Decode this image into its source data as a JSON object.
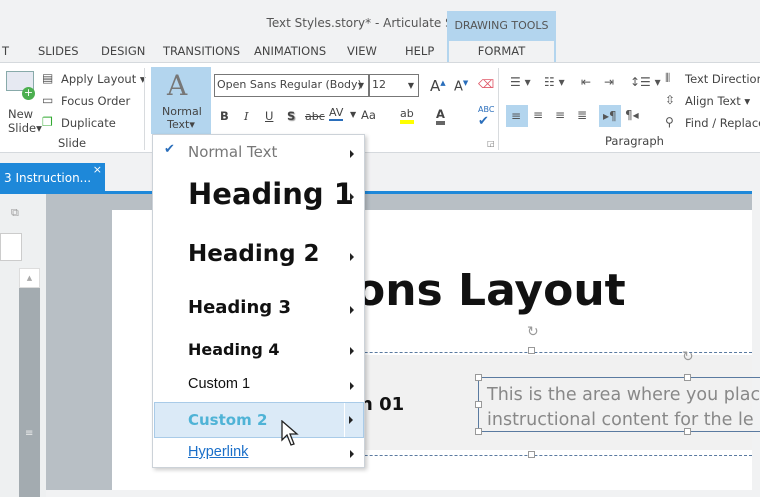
{
  "window": {
    "title": "Text Styles.story* -  Articulate Storyline"
  },
  "tabs": [
    "T",
    "SLIDES",
    "DESIGN",
    "TRANSITIONS",
    "ANIMATIONS",
    "VIEW",
    "HELP"
  ],
  "contextual": {
    "group": "DRAWING TOOLS",
    "tab": "FORMAT"
  },
  "ribbon": {
    "slide": {
      "new_slide": [
        "New",
        "Slide"
      ],
      "apply_layout": "Apply Layout",
      "focus_order": "Focus Order",
      "duplicate": "Duplicate",
      "group": "Slide"
    },
    "style_button": [
      "Normal",
      "Text"
    ],
    "font": {
      "name": "Open Sans Regular (Body)",
      "size": "12"
    },
    "format": {
      "bold": "B",
      "italic": "I",
      "underline": "U",
      "shadow": "S",
      "strike": "abc",
      "spacing": "AV",
      "case": "Aa",
      "highlight_color": "#ffff00"
    },
    "paragraph": {
      "group": "Paragraph",
      "text_direction": "Text Direction",
      "align_text": "Align Text",
      "find_replace": "Find / Replace"
    }
  },
  "doc_tab": {
    "label": "3 Instruction...",
    "close": "×",
    "color": "#1e88d9"
  },
  "menu": {
    "items": [
      {
        "label": "Normal Text",
        "checked": true
      },
      {
        "label": "Heading 1"
      },
      {
        "label": "Heading 2"
      },
      {
        "label": "Heading 3"
      },
      {
        "label": "Heading 4"
      },
      {
        "label": "Custom 1"
      },
      {
        "label": "Custom 2",
        "hovered": true
      },
      {
        "label": "Hyperlink"
      }
    ]
  },
  "slide": {
    "title": "ons Layout",
    "section": "n 01",
    "body": [
      "This is the area where you plac",
      "instructional content for the le"
    ]
  }
}
